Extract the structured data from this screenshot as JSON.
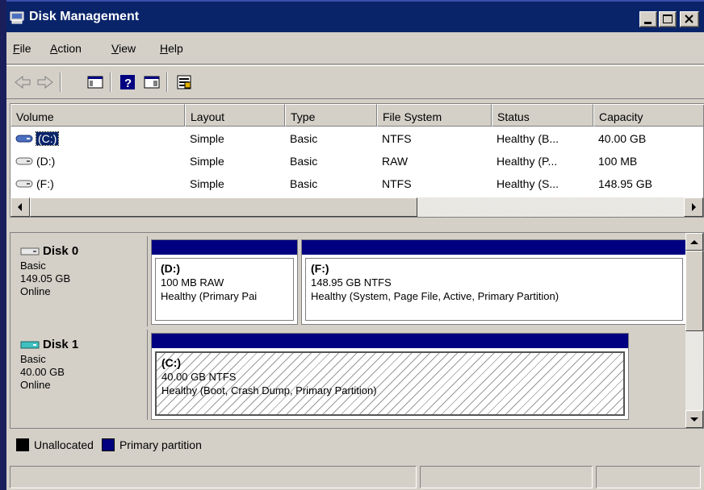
{
  "window": {
    "title": "Disk Management"
  },
  "menu": [
    {
      "key": "F",
      "rest": "ile"
    },
    {
      "key": "A",
      "rest": "ction"
    },
    {
      "key": "V",
      "rest": "iew"
    },
    {
      "key": "H",
      "rest": "elp"
    }
  ],
  "toolbar": {
    "icons": [
      "back-icon",
      "forward-icon",
      "show-hide-console-tree-icon",
      "help-icon",
      "show-hide-action-pane-icon",
      "properties-icon"
    ]
  },
  "volume_list": {
    "columns": [
      "Volume",
      "Layout",
      "Type",
      "File System",
      "Status",
      "Capacity"
    ],
    "rows": [
      {
        "volume": "(C:)",
        "layout": "Simple",
        "type": "Basic",
        "fs": "NTFS",
        "status": "Healthy (B...",
        "capacity": "40.00 GB",
        "selected": true
      },
      {
        "volume": "(D:)",
        "layout": "Simple",
        "type": "Basic",
        "fs": "RAW",
        "status": "Healthy (P...",
        "capacity": "100 MB",
        "selected": false
      },
      {
        "volume": "(F:)",
        "layout": "Simple",
        "type": "Basic",
        "fs": "NTFS",
        "status": "Healthy (S...",
        "capacity": "148.95 GB",
        "selected": false
      }
    ]
  },
  "disks": [
    {
      "name": "Disk 0",
      "type": "Basic",
      "size": "149.05 GB",
      "state": "Online",
      "partitions": [
        {
          "name": "(D:)",
          "detail": "100 MB RAW",
          "status": "Healthy (Primary Pai"
        },
        {
          "name": "(F:)",
          "detail": "148.95 GB NTFS",
          "status": "Healthy (System, Page File, Active, Primary Partition)"
        }
      ]
    },
    {
      "name": "Disk 1",
      "type": "Basic",
      "size": "40.00 GB",
      "state": "Online",
      "partitions": [
        {
          "name": "(C:)",
          "detail": "40.00 GB NTFS",
          "status": "Healthy (Boot, Crash Dump, Primary Partition)"
        }
      ]
    }
  ],
  "legend": {
    "unallocated": "Unallocated",
    "primary": "Primary partition",
    "unallocated_color": "#000000",
    "primary_color": "#000080"
  },
  "colors": {
    "title_bar": "#0a246a",
    "partition_bar": "#000080",
    "chrome": "#d4d0c8"
  }
}
